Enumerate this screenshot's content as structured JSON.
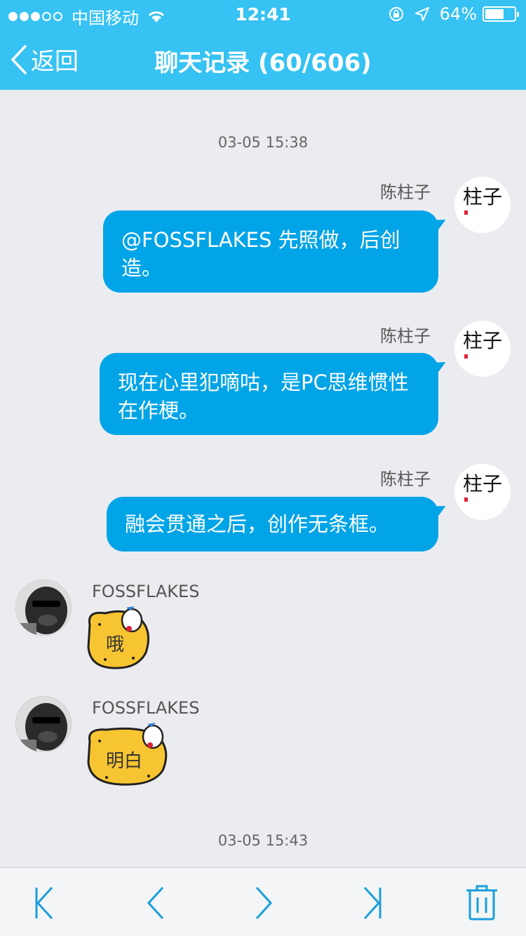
{
  "status": {
    "carrier": "中国移动",
    "time": "12:41",
    "battery": "64%",
    "battery_level": 0.64
  },
  "nav": {
    "back_label": "返回",
    "title": "聊天记录 (60/606)"
  },
  "messages": [
    {
      "timestamp": "03-05 15:38"
    },
    {
      "sender": "陈柱子",
      "text": "@FOSSFLAKES 先照做，后创造。"
    },
    {
      "sender": "陈柱子",
      "text": "现在心里犯嘀咕，是PC思维惯性在作梗。"
    },
    {
      "sender": "陈柱子",
      "text": "融会贯通之后，创作无条框。"
    },
    {
      "sender": "FOSSFLAKES",
      "sticker": "哦"
    },
    {
      "sender": "FOSSFLAKES",
      "sticker": "明白"
    },
    {
      "timestamp": "03-05 15:43"
    }
  ],
  "avatars": {
    "me_glyph": "柱子"
  },
  "colors": {
    "header": "#36c2f3",
    "bubble": "#00a4e7",
    "accent": "#1a9fd9",
    "sticker": "#f7c531"
  },
  "toolbar": [
    "first-page-icon",
    "prev-page-icon",
    "next-page-icon",
    "last-page-icon",
    "trash-icon"
  ]
}
